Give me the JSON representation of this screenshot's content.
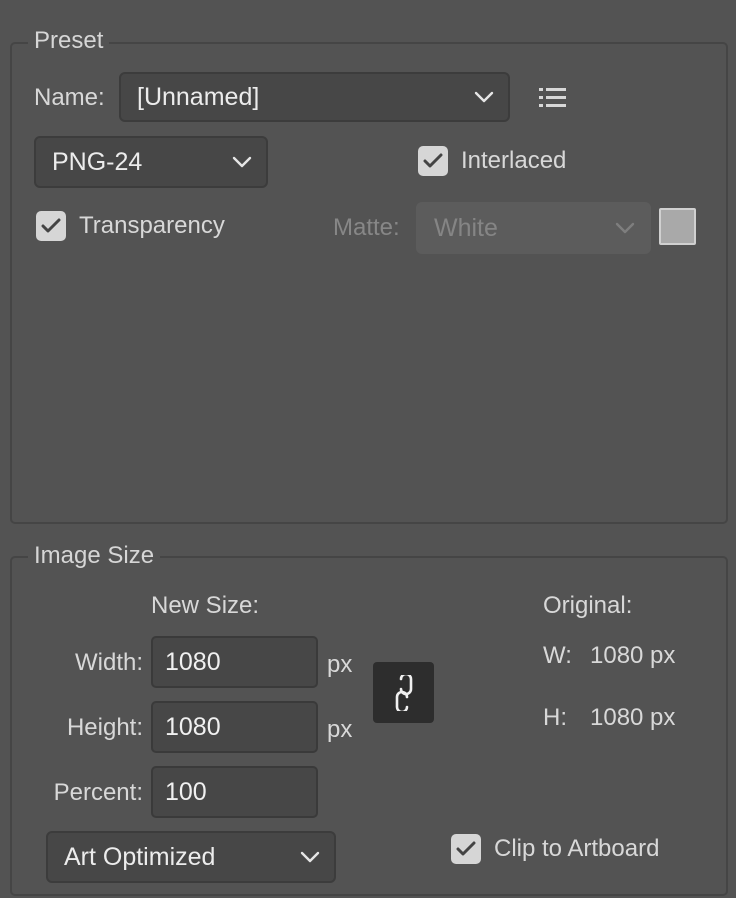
{
  "preset": {
    "legend": "Preset",
    "name_label": "Name:",
    "name_value": "[Unnamed]",
    "format_value": "PNG-24",
    "interlaced_label": "Interlaced",
    "interlaced_checked": true,
    "transparency_label": "Transparency",
    "transparency_checked": true,
    "matte_label": "Matte:",
    "matte_value": "White",
    "matte_disabled": true,
    "matte_swatch_color": "#a9a9a9"
  },
  "image_size": {
    "legend": "Image Size",
    "new_size_label": "New Size:",
    "width_label": "Width:",
    "width_value": "1080",
    "width_unit": "px",
    "height_label": "Height:",
    "height_value": "1080",
    "height_unit": "px",
    "percent_label": "Percent:",
    "percent_value": "100",
    "original_label": "Original:",
    "orig_w_label": "W:",
    "orig_w_value": "1080 px",
    "orig_h_label": "H:",
    "orig_h_value": "1080 px",
    "quality_value": "Art Optimized",
    "clip_label": "Clip to Artboard",
    "clip_checked": true
  },
  "icons": {
    "presets_menu": "list-icon",
    "constrain": "link-icon",
    "dropdown": "chevron-down-icon",
    "checkbox": "checkmark-icon"
  }
}
